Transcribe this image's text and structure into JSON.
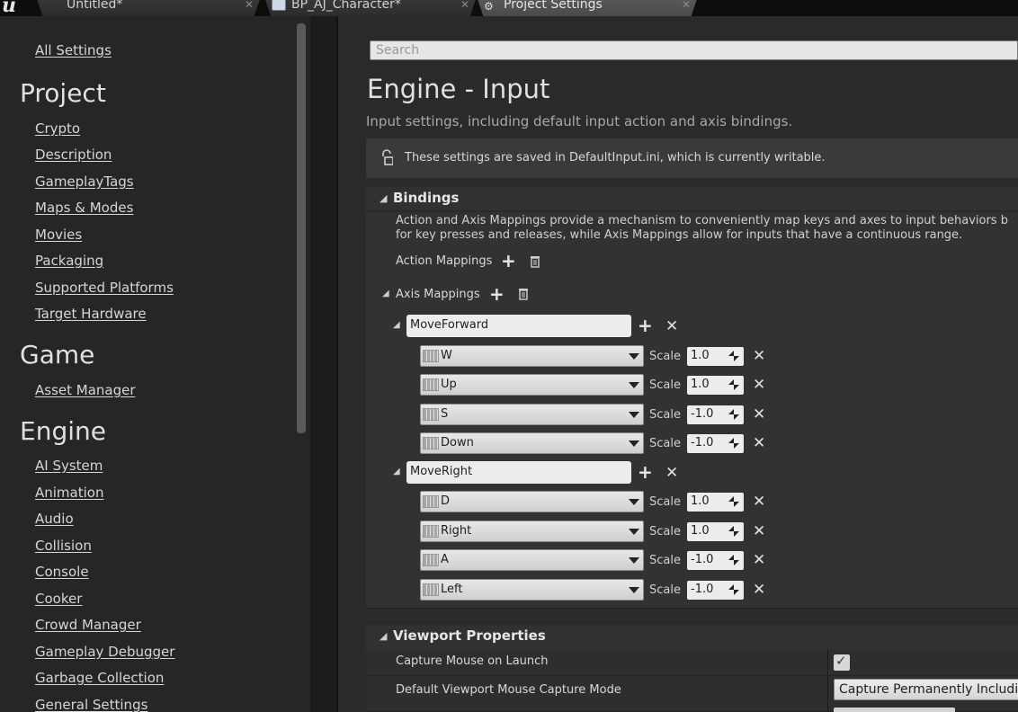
{
  "tabs": [
    {
      "label": "Untitled*"
    },
    {
      "label": "BP_AJ_Character*"
    },
    {
      "label": "Project Settings"
    }
  ],
  "sidebar": {
    "all_settings": "All Settings",
    "sections": [
      {
        "heading": "Project",
        "items": [
          "Crypto",
          "Description",
          "GameplayTags",
          "Maps & Modes",
          "Movies",
          "Packaging",
          "Supported Platforms",
          "Target Hardware"
        ]
      },
      {
        "heading": "Game",
        "items": [
          "Asset Manager"
        ]
      },
      {
        "heading": "Engine",
        "items": [
          "AI System",
          "Animation",
          "Audio",
          "Collision",
          "Console",
          "Cooker",
          "Crowd Manager",
          "Gameplay Debugger",
          "Garbage Collection",
          "General Settings"
        ]
      }
    ]
  },
  "search": {
    "placeholder": "Search"
  },
  "page": {
    "title": "Engine - Input",
    "subtitle": "Input settings, including default input action and axis bindings.",
    "notice": "These settings are saved in DefaultInput.ini, which is currently writable."
  },
  "bindings": {
    "heading": "Bindings",
    "description_line1": "Action and Axis Mappings provide a mechanism to conveniently map keys and axes to input behaviors b",
    "description_line2": "for key presses and releases, while Axis Mappings allow for inputs that have a continuous range.",
    "action_mappings_label": "Action Mappings",
    "axis_mappings_label": "Axis Mappings",
    "scale_label": "Scale",
    "axes": [
      {
        "name": "MoveForward",
        "keys": [
          {
            "key": "W",
            "scale": "1.0"
          },
          {
            "key": "Up",
            "scale": "1.0"
          },
          {
            "key": "S",
            "scale": "-1.0"
          },
          {
            "key": "Down",
            "scale": "-1.0"
          }
        ]
      },
      {
        "name": "MoveRight",
        "keys": [
          {
            "key": "D",
            "scale": "1.0"
          },
          {
            "key": "Right",
            "scale": "1.0"
          },
          {
            "key": "A",
            "scale": "-1.0"
          },
          {
            "key": "Left",
            "scale": "-1.0"
          }
        ]
      }
    ]
  },
  "viewport": {
    "heading": "Viewport Properties",
    "capture_mouse_label": "Capture Mouse on Launch",
    "capture_mouse_checked": true,
    "capture_mode_label": "Default Viewport Mouse Capture Mode",
    "capture_mode_value": "Capture Permanently Including"
  }
}
